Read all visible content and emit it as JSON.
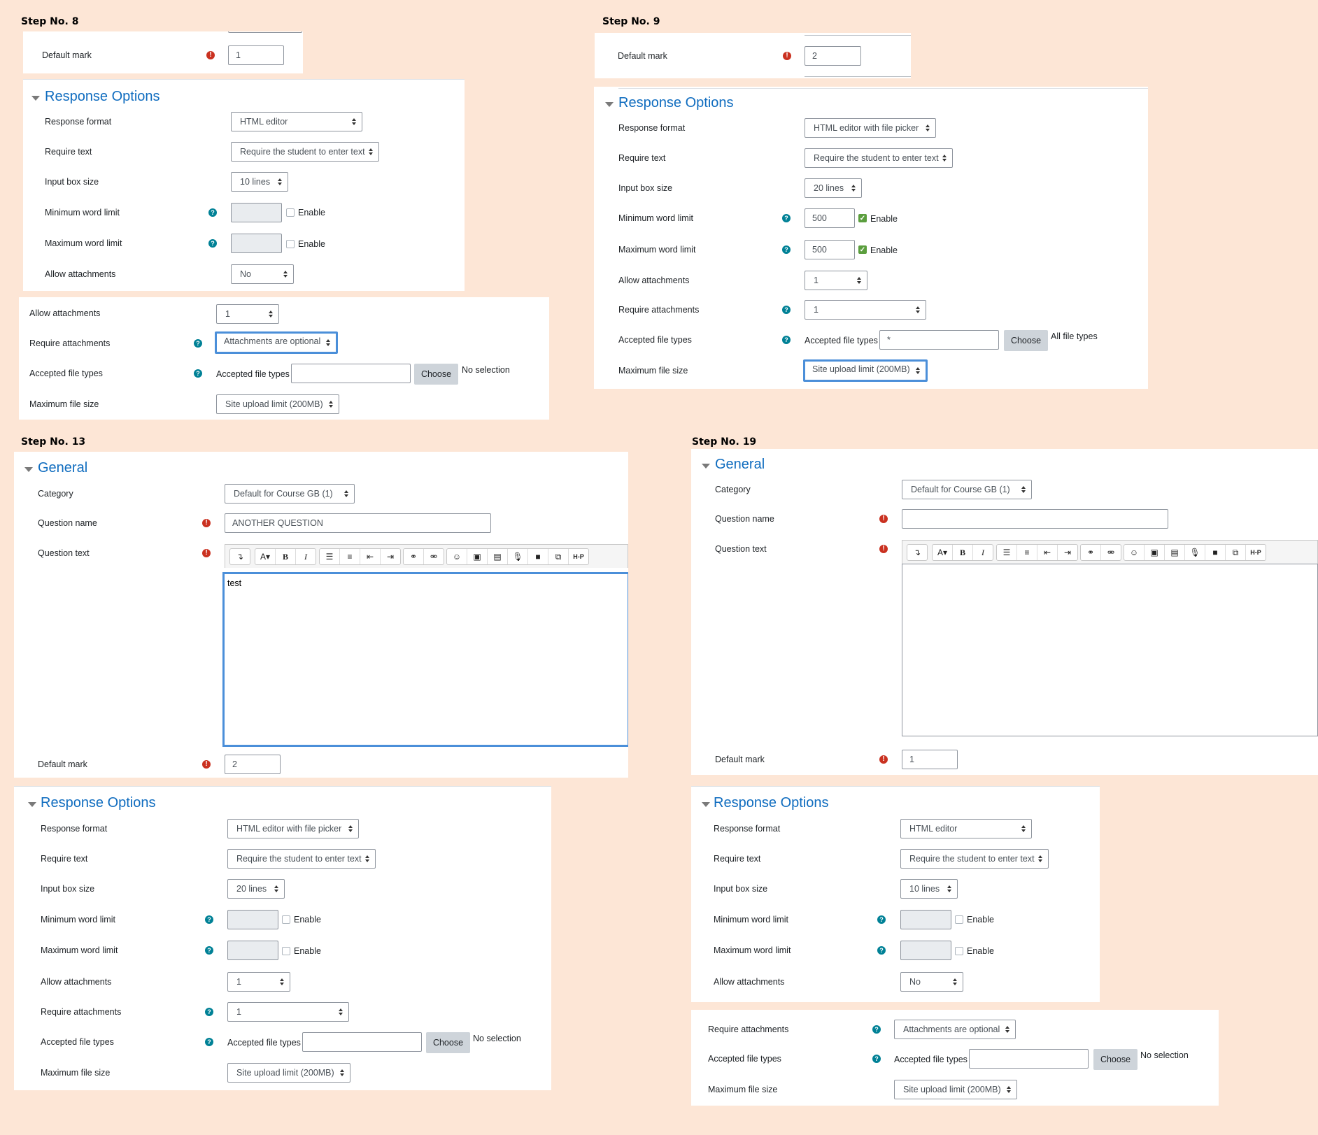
{
  "steps": {
    "s8": "Step No. 8",
    "s9": "Step No. 9",
    "s13": "Step No. 13",
    "s19": "Step No. 19"
  },
  "labels": {
    "default_mark": "Default mark",
    "response_options": "Response Options",
    "general": "General",
    "response_format": "Response format",
    "require_text": "Require text",
    "input_box_size": "Input box size",
    "min_word_limit": "Minimum word limit",
    "max_word_limit": "Maximum word limit",
    "allow_attachments": "Allow attachments",
    "require_attachments": "Require attachments",
    "accepted_file_types": "Accepted file types",
    "maximum_file_size": "Maximum file size",
    "category": "Category",
    "question_name": "Question name",
    "question_text": "Question text",
    "enable": "Enable",
    "choose": "Choose"
  },
  "icons": {
    "required": "!",
    "help": "?",
    "check": "✓"
  },
  "step8": {
    "default_mark": "1",
    "response_format": "HTML editor",
    "require_text": "Require the student to enter text",
    "input_box_size": "10 lines",
    "allow_attachments": "No",
    "allow_attachments_2": "1",
    "require_attachments": "Attachments are optional",
    "file_types_status": "No selection",
    "max_file_size": "Site upload limit (200MB)"
  },
  "step9": {
    "default_mark": "2",
    "response_format": "HTML editor with file picker",
    "require_text": "Require the student to enter text",
    "input_box_size": "20 lines",
    "min_word": "500",
    "max_word": "500",
    "allow_attachments": "1",
    "require_attachments": "1",
    "file_types_value": "*",
    "file_types_status": "All file types",
    "max_file_size": "Site upload limit (200MB)"
  },
  "step13": {
    "category": "Default for Course GB (1)",
    "question_name": "ANOTHER QUESTION",
    "question_text": "test",
    "default_mark": "2",
    "response_format": "HTML editor with file picker",
    "require_text": "Require the student to enter text",
    "input_box_size": "20 lines",
    "allow_attachments": "1",
    "require_attachments": "1",
    "file_types_status": "No selection",
    "max_file_size": "Site upload limit (200MB)"
  },
  "step19": {
    "category": "Default for Course GB (1)",
    "question_name": "",
    "default_mark": "1",
    "response_format": "HTML editor",
    "require_text": "Require the student to enter text",
    "input_box_size": "10 lines",
    "allow_attachments": "No",
    "require_attachments": "Attachments are optional",
    "file_types_status": "No selection",
    "max_file_size": "Site upload limit (200MB)"
  },
  "toolbar": {
    "g1": [
      "↴"
    ],
    "g2": [
      "A▾",
      "B",
      "I"
    ],
    "g3": [
      "☰",
      "≡",
      "⇤",
      "⇥"
    ],
    "g4": [
      "⚭",
      "⚮"
    ],
    "g5": [
      "☺",
      "▣",
      "▤",
      "🎙",
      "■",
      "⧉",
      "H-P"
    ]
  }
}
